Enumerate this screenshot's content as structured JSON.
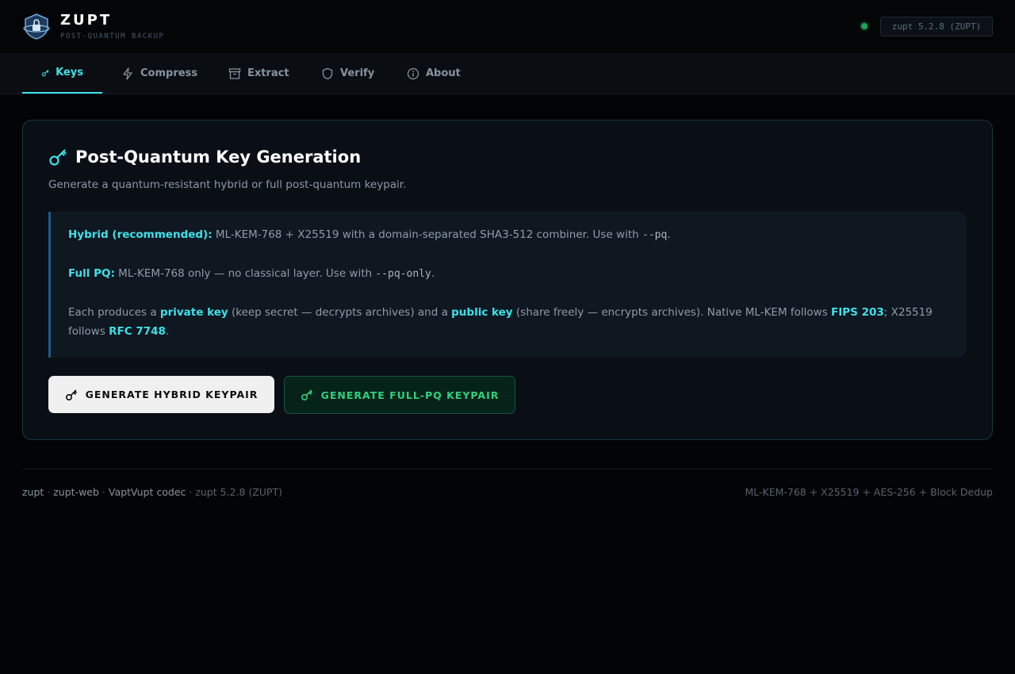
{
  "app": {
    "name": "ZUPT",
    "subtitle": "POST-QUANTUM BACKUP",
    "version_badge": "zupt 5.2.8 (ZUPT)",
    "status_color": "#1fa35a",
    "accent": "#3ee0e8"
  },
  "tabs": [
    {
      "label": "Keys",
      "icon": "key-icon",
      "active": true
    },
    {
      "label": "Compress",
      "icon": "lightning-icon",
      "active": false
    },
    {
      "label": "Extract",
      "icon": "archive-icon",
      "active": false
    },
    {
      "label": "Verify",
      "icon": "shield-icon",
      "active": false
    },
    {
      "label": "About",
      "icon": "info-icon",
      "active": false
    }
  ],
  "card": {
    "title": "Post-Quantum Key Generation",
    "subtitle": "Generate a quantum-resistant hybrid or full post-quantum keypair.",
    "info": {
      "hybrid_label": "Hybrid (recommended):",
      "hybrid_text": " ML-KEM-768 + X25519 with a domain-separated SHA3-512 combiner. Use with ",
      "hybrid_flag": "--pq",
      "hybrid_end": ".",
      "fullpq_label": "Full PQ:",
      "fullpq_text": " ML-KEM-768 only — no classical layer. Use with ",
      "fullpq_flag": "--pq-only",
      "fullpq_end": ".",
      "each_text_1": "Each produces a ",
      "private_key": "private key",
      "each_text_2": " (keep secret — decrypts archives) and a ",
      "public_key": "public key",
      "each_text_3": " (share freely — encrypts archives). Native ML-KEM follows ",
      "fips": "FIPS 203",
      "each_text_4": "; X25519 follows ",
      "rfc": "RFC 7748",
      "each_end": "."
    },
    "buttons": {
      "hybrid": "GENERATE HYBRID KEYPAIR",
      "fullpq": "GENERATE FULL-PQ KEYPAIR"
    }
  },
  "footer": {
    "link_zupt": "zupt",
    "sep": " · ",
    "link_zupt_web": "zupt-web",
    "link_codec": "VaptVupt codec",
    "version": "zupt 5.2.8 (ZUPT)",
    "tech": "ML-KEM-768 + X25519 + AES-256 + Block Dedup"
  }
}
